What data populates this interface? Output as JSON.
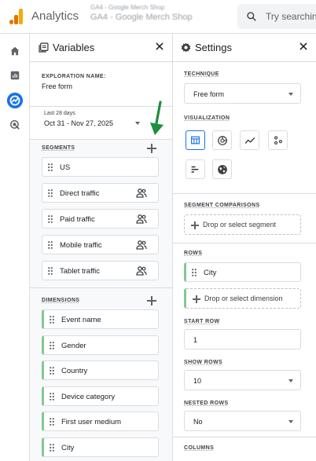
{
  "app": {
    "title": "Analytics",
    "account_line1": "GA4 - Google Merch Shop",
    "account_line2": "GA4 - Google Merch Shop",
    "search_placeholder": "Try searching"
  },
  "rail": {
    "items": [
      "home-icon",
      "reports-icon",
      "explore-icon",
      "advertising-icon"
    ]
  },
  "variables": {
    "title": "Variables",
    "exploration_name_label": "EXPLORATION NAME:",
    "exploration_name": "Free form",
    "date_preset": "Last 28 days",
    "date_range": "Oct 31 - Nov 27, 2025",
    "segments_label": "SEGMENTS",
    "segments": [
      {
        "label": "US",
        "has_people_icon": false
      },
      {
        "label": "Direct traffic",
        "has_people_icon": true
      },
      {
        "label": "Paid traffic",
        "has_people_icon": true
      },
      {
        "label": "Mobile traffic",
        "has_people_icon": true
      },
      {
        "label": "Tablet traffic",
        "has_people_icon": true
      }
    ],
    "dimensions_label": "DIMENSIONS",
    "dimensions": [
      "Event name",
      "Gender",
      "Country",
      "Device category",
      "First user medium",
      "City"
    ]
  },
  "settings": {
    "title": "Settings",
    "technique_label": "TECHNIQUE",
    "technique": "Free form",
    "visualization_label": "VISUALIZATION",
    "visualizations": [
      "table-icon",
      "donut-chart-icon",
      "line-chart-icon",
      "scatter-plot-icon",
      "bar-chart-icon",
      "geo-map-icon"
    ],
    "segment_comparisons_label": "SEGMENT COMPARISONS",
    "segment_drop": "Drop or select segment",
    "rows_label": "ROWS",
    "rows": [
      "City"
    ],
    "dimension_drop": "Drop or select dimension",
    "start_row_label": "START ROW",
    "start_row": "1",
    "show_rows_label": "SHOW ROWS",
    "show_rows": "10",
    "nested_rows_label": "NESTED ROWS",
    "nested_rows": "No",
    "columns_label": "COLUMNS"
  },
  "colors": {
    "accent": "#1a73e8",
    "logo_orange": "#f9ab00",
    "logo_dark": "#e37400",
    "dimension_green": "#81c995",
    "annotation_arrow": "#1e8e3e"
  }
}
